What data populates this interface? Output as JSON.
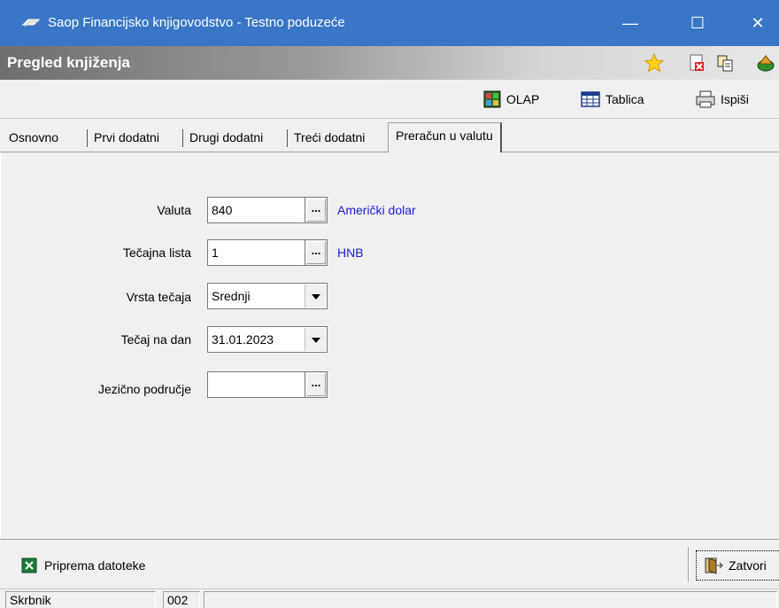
{
  "window": {
    "title": "Saop Financijsko knjigovodstvo - Testno poduzeće",
    "minimize": "—",
    "maximize": "☐",
    "close": "✕"
  },
  "subheader": {
    "title": "Pregled knjiženja",
    "icons": [
      "star-icon",
      "delete-document-icon",
      "copy-icon",
      "export-icon"
    ]
  },
  "toolbar": {
    "olap": "OLAP",
    "tablica": "Tablica",
    "ispisi": "Ispiši"
  },
  "tabs": [
    {
      "label": "Osnovno"
    },
    {
      "label": "Prvi dodatni"
    },
    {
      "label": "Drugi dodatni"
    },
    {
      "label": "Treći dodatni"
    },
    {
      "label": "Preračun u valutu",
      "active": true
    }
  ],
  "form": {
    "valuta": {
      "label": "Valuta",
      "value": "840",
      "desc": "Američki dolar"
    },
    "tecajna_lista": {
      "label": "Tečajna lista",
      "value": "1",
      "desc": "HNB"
    },
    "vrsta_tecaja": {
      "label": "Vrsta tečaja",
      "value": "Srednji"
    },
    "tecaj_na_dan": {
      "label": "Tečaj na dan",
      "value": "31.01.2023"
    },
    "jezicno_podrucje": {
      "label": "Jezično područje",
      "value": ""
    },
    "browse_label": "..."
  },
  "bottom": {
    "priprema": "Priprema datoteke",
    "zatvori": "Zatvori"
  },
  "status": {
    "user": "Skrbnik",
    "code": "002"
  },
  "colors": {
    "titlebar": "#3a76c6",
    "link": "#1a1ae6"
  }
}
